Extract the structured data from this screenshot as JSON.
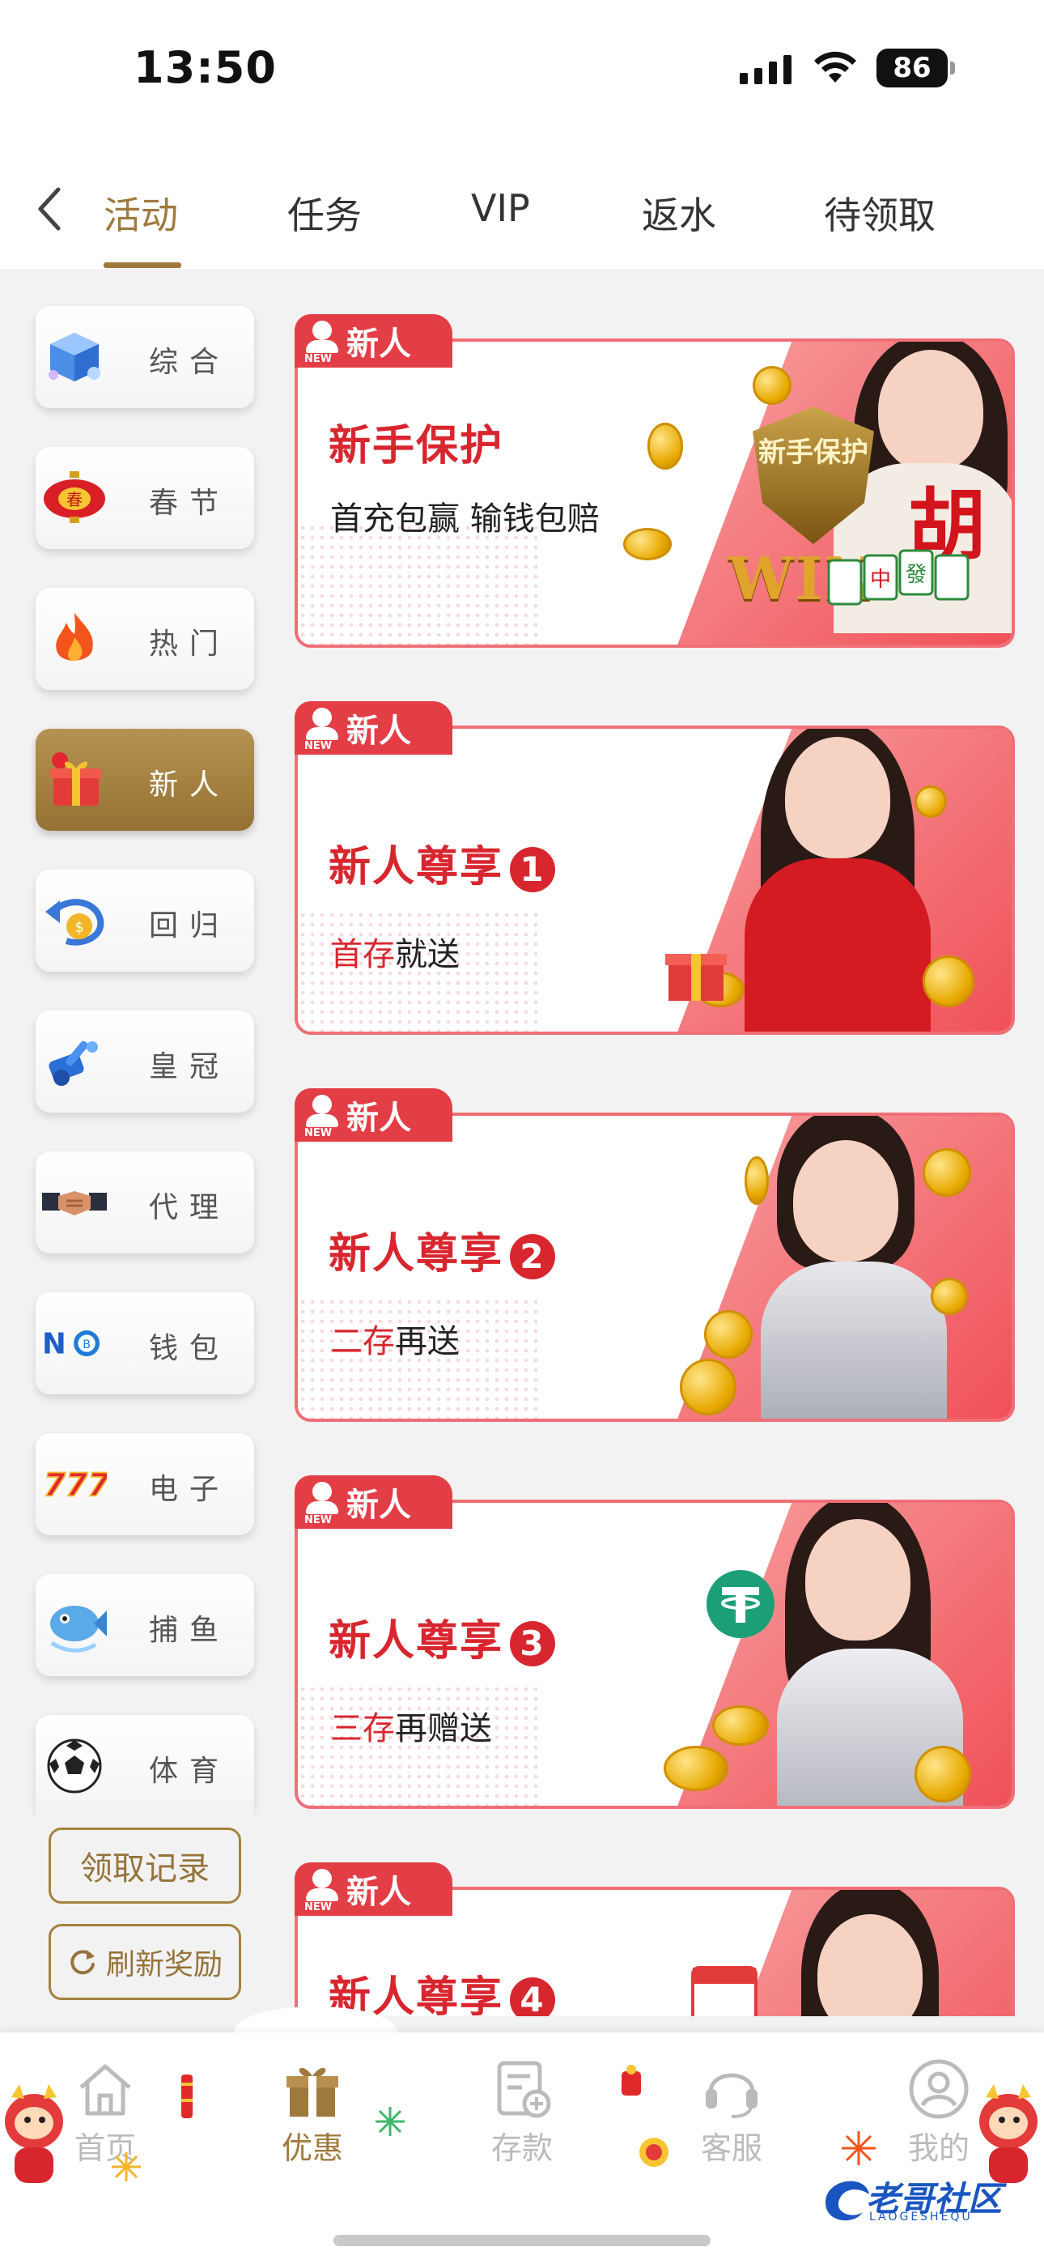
{
  "status_bar": {
    "time": "13:50",
    "battery": "86"
  },
  "tabs": [
    {
      "label": "活动",
      "active": true
    },
    {
      "label": "任务"
    },
    {
      "label": "VIP"
    },
    {
      "label": "返水"
    },
    {
      "label": "待领取"
    }
  ],
  "sidebar": {
    "items": [
      {
        "label": "综合",
        "icon": "cube-icon"
      },
      {
        "label": "春节",
        "icon": "lantern-icon"
      },
      {
        "label": "热门",
        "icon": "fire-icon"
      },
      {
        "label": "新人",
        "icon": "gift-icon",
        "active": true
      },
      {
        "label": "回归",
        "icon": "return-coin-icon"
      },
      {
        "label": "皇冠",
        "icon": "crown-icon"
      },
      {
        "label": "代理",
        "icon": "handshake-icon"
      },
      {
        "label": "钱包",
        "icon": "wallet-icon",
        "icon_text": "NO"
      },
      {
        "label": "电子",
        "icon": "slot-777-icon",
        "icon_text": "777"
      },
      {
        "label": "捕鱼",
        "icon": "fish-icon"
      },
      {
        "label": "体育",
        "icon": "soccer-ball-icon"
      }
    ],
    "records_label": "领取记录",
    "refresh_label": "刷新奖励"
  },
  "banners": [
    {
      "tag": "新人",
      "tag_sub": "NEW",
      "title": "新手保护",
      "number": "",
      "sub_highlight": "",
      "sub_rest": "首充包赢 输钱包赔",
      "art_text": "新手保护",
      "art_win": "WIN"
    },
    {
      "tag": "新人",
      "tag_sub": "NEW",
      "title": "新人尊享",
      "number": "1",
      "sub_highlight": "首存",
      "sub_rest": "就送"
    },
    {
      "tag": "新人",
      "tag_sub": "NEW",
      "title": "新人尊享",
      "number": "2",
      "sub_highlight": "二存",
      "sub_rest": "再送"
    },
    {
      "tag": "新人",
      "tag_sub": "NEW",
      "title": "新人尊享",
      "number": "3",
      "sub_highlight": "三存",
      "sub_rest": "再赠送"
    },
    {
      "tag": "新人",
      "tag_sub": "NEW",
      "title": "新人尊享",
      "number": "4",
      "sub_highlight": "",
      "sub_rest": ""
    }
  ],
  "bottom_nav": [
    {
      "label": "首页",
      "icon": "home-icon"
    },
    {
      "label": "优惠",
      "icon": "gift-box-icon",
      "active": true
    },
    {
      "label": "存款",
      "icon": "deposit-icon"
    },
    {
      "label": "客服",
      "icon": "headset-icon"
    },
    {
      "label": "我的",
      "icon": "user-icon"
    }
  ],
  "watermark": {
    "text": "老哥社区",
    "sub": "LAOGESHEQU"
  },
  "colors": {
    "accent": "#a0793d",
    "banner_red": "#d8262f",
    "banner_border": "#f06f77"
  }
}
